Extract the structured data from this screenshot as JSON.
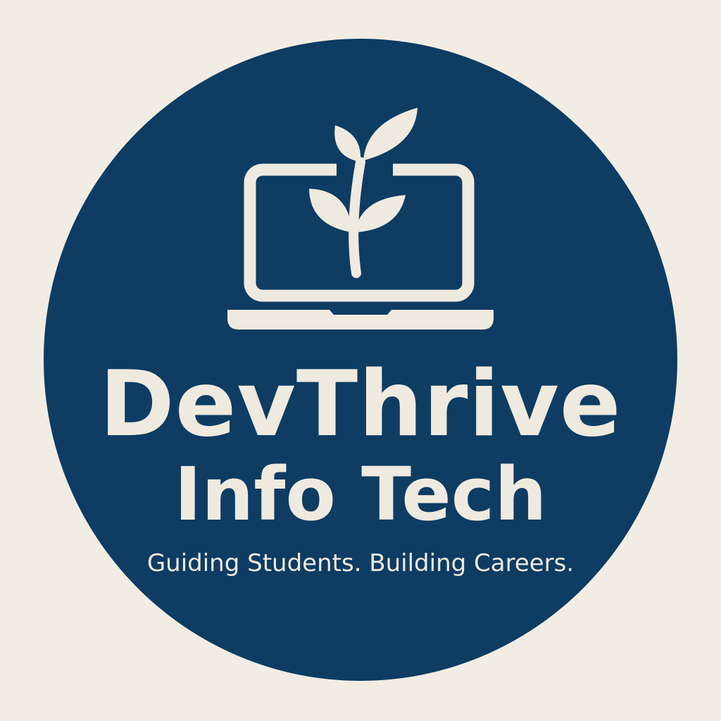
{
  "logo": {
    "brand_name": "DevThrive",
    "brand_sub": "Info Tech",
    "tagline": "Guiding Students. Building Careers.",
    "icon": "laptop-sprout-icon"
  },
  "colors": {
    "background": "#F1EDE4",
    "circle": "#0E3C63",
    "foreground": "#EFEADF"
  }
}
